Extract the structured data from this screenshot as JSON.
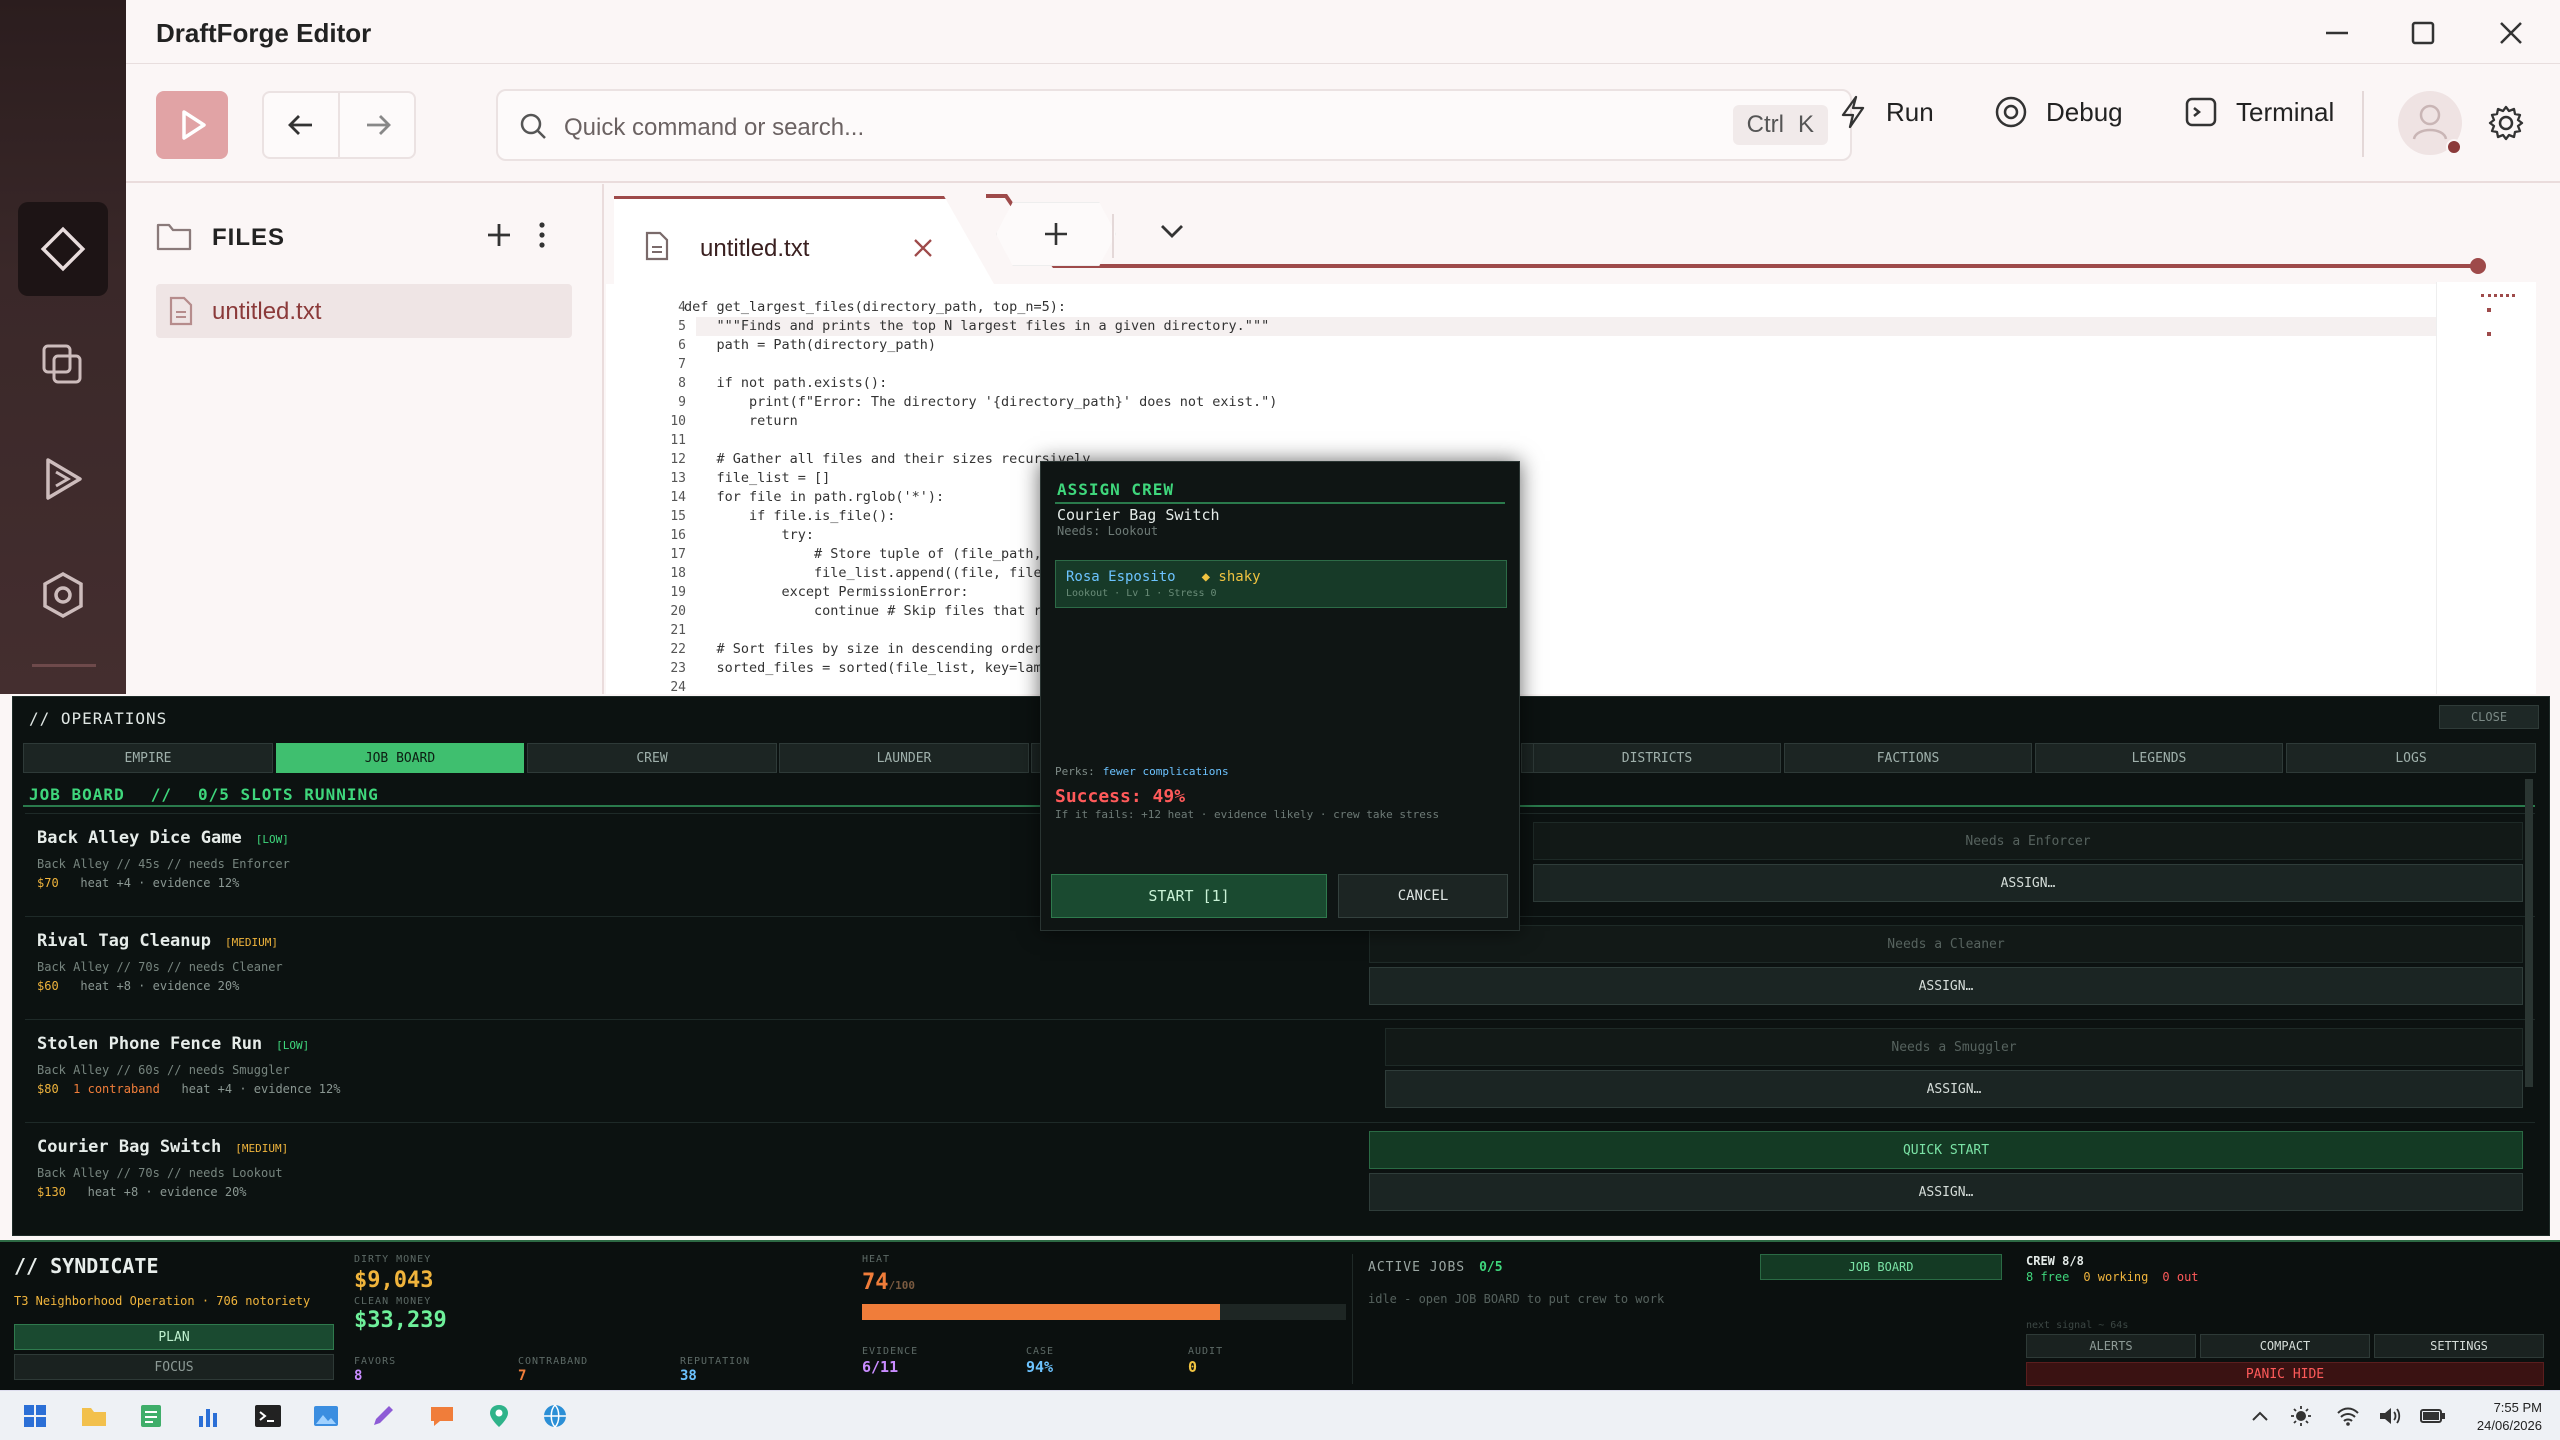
{
  "app": {
    "title": "DraftForge Editor"
  },
  "toolbar": {
    "search_placeholder": "Quick command or search...",
    "shortcut_ctrl": "Ctrl",
    "shortcut_key": "K",
    "run": "Run",
    "debug": "Debug",
    "terminal": "Terminal"
  },
  "files": {
    "title": "FILES",
    "items": [
      "untitled.txt"
    ]
  },
  "editor": {
    "tab": "untitled.txt",
    "line_numbers": [
      "4",
      "5",
      "6",
      "7",
      "8",
      "9",
      "10",
      "11",
      "12",
      "13",
      "14",
      "15",
      "16",
      "17",
      "18",
      "19",
      "20",
      "21",
      "22",
      "23",
      "24"
    ],
    "code": "def get_largest_files(directory_path, top_n=5):\n    \"\"\"Finds and prints the top N largest files in a given directory.\"\"\"\n    path = Path(directory_path)\n\n    if not path.exists():\n        print(f\"Error: The directory '{directory_path}' does not exist.\")\n        return\n\n    # Gather all files and their sizes recursively\n    file_list = []\n    for file in path.rglob('*'):\n        if file.is_file():\n            try:\n                # Store tuple of (file_path, f\n                file_list.append((file, file.s\n            except PermissionError:\n                continue # Skip files that req\n\n    # Sort files by size in descending order\n    sorted_files = sorted(file_list, key=lambd\n"
  },
  "ops": {
    "title": "// OPERATIONS",
    "close": "CLOSE",
    "tabs": [
      "EMPIRE",
      "JOB BOARD",
      "CREW",
      "LAUNDER",
      "",
      "",
      "DISTRICTS",
      "FACTIONS",
      "LEGENDS",
      "LOGS"
    ],
    "active_tab": "JOB BOARD",
    "board_title": "JOB BOARD",
    "board_sep": "//",
    "slots": "0/5 SLOTS RUNNING",
    "jobs": [
      {
        "name": "Back Alley Dice Game",
        "risk": "[LOW]",
        "sub": "Back Alley  //  45s  //  needs Enforcer",
        "money": "$70",
        "extra": "",
        "stats": "heat +4 · evidence 12%",
        "needs": "Needs a Enforcer",
        "assign": "ASSIGN…"
      },
      {
        "name": "Rival Tag Cleanup",
        "risk": "[MEDIUM]",
        "sub": "Back Alley  //  70s  //  needs Cleaner",
        "money": "$60",
        "extra": "",
        "stats": "heat +8 · evidence 20%",
        "needs": "Needs a Cleaner",
        "assign": "ASSIGN…"
      },
      {
        "name": "Stolen Phone Fence Run",
        "risk": "[LOW]",
        "sub": "Back Alley  //  60s  //  needs Smuggler",
        "money": "$80",
        "extra": "1 contraband",
        "stats": "heat +4 · evidence 12%",
        "needs": "Needs a Smuggler",
        "assign": "ASSIGN…"
      },
      {
        "name": "Courier Bag Switch",
        "risk": "[MEDIUM]",
        "sub": "Back Alley  //  70s  //  needs Lookout",
        "money": "$130",
        "extra": "",
        "stats": "heat +8 · evidence 20%",
        "needs": "QUICK START",
        "assign": "ASSIGN…"
      }
    ]
  },
  "modal": {
    "title": "ASSIGN CREW",
    "job": "Courier Bag Switch",
    "needs": "Needs: Lookout",
    "crew_name": "Rosa Esposito",
    "crew_trait": "◆ shaky",
    "crew_sub": "Lookout · Lv 1 · Stress 0",
    "perks_label": "Perks:",
    "perks_value": "fewer complications",
    "success": "Success: 49%",
    "fail": "If it fails: +12 heat · evidence likely · crew take stress",
    "start": "START [1]",
    "cancel": "CANCEL"
  },
  "syndicate": {
    "title": "// SYNDICATE",
    "subtitle": "T3 Neighborhood Operation · 706 notoriety",
    "plan": "PLAN",
    "focus": "FOCUS",
    "dirty_label": "DIRTY MONEY",
    "dirty": "$9,043",
    "clean_label": "CLEAN MONEY",
    "clean": "$33,239",
    "favors_label": "FAVORS",
    "favors": "8",
    "contraband_label": "CONTRABAND",
    "contraband": "7",
    "reputation_label": "REPUTATION",
    "reputation": "38",
    "heat_label": "HEAT",
    "heat": "74",
    "heat_max": "/100",
    "heat_pct": 0.74,
    "evidence_label": "EVIDENCE",
    "evidence": "6/11",
    "case_label": "CASE",
    "case": "94%",
    "audit_label": "AUDIT",
    "audit": "0",
    "active_label": "ACTIVE JOBS",
    "active": "0/5",
    "idle": "idle - open JOB BOARD to put crew to work",
    "job_board_btn": "JOB BOARD",
    "crew": "CREW 8/8",
    "crew_free": "8 free",
    "crew_working": "0 working",
    "crew_out": "0 out",
    "next_signal": "next signal ~ 64s",
    "alerts": "ALERTS",
    "compact": "COMPACT",
    "settings": "SETTINGS",
    "panic": "PANIC HIDE"
  },
  "taskbar": {
    "time": "7:55 PM",
    "date": "24/06/2026"
  },
  "colors": {
    "accent": "#9e4a4a",
    "ops_green": "#3fbf6f",
    "heat_orange": "#f07d3a"
  }
}
